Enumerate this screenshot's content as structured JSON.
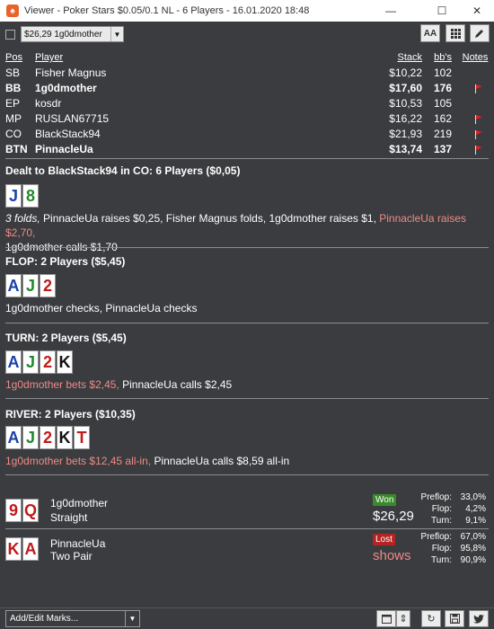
{
  "window": {
    "title": "Viewer - Poker Stars $0.05/0.1 NL - 6 Players - 16.01.2020 18:48",
    "app_icon": "pokerstars-logo-icon"
  },
  "toolbar": {
    "selected_hand": "$26,29 1g0dmother",
    "font_button": "AA",
    "grid_button_icon": "grid-icon",
    "edit_button_icon": "pencil-icon"
  },
  "players": {
    "headers": {
      "pos": "Pos",
      "player": "Player",
      "stack": "Stack",
      "bbs": "bb's",
      "notes": "Notes"
    },
    "rows": [
      {
        "pos": "SB",
        "player": "Fisher Magnus",
        "stack": "$10,22",
        "bbs": "102",
        "flag": false,
        "bold": false
      },
      {
        "pos": "BB",
        "player": "1g0dmother",
        "stack": "$17,60",
        "bbs": "176",
        "flag": true,
        "bold": true
      },
      {
        "pos": "EP",
        "player": "kosdr",
        "stack": "$10,53",
        "bbs": "105",
        "flag": false,
        "bold": false
      },
      {
        "pos": "MP",
        "player": "RUSLAN67715",
        "stack": "$16,22",
        "bbs": "162",
        "flag": true,
        "bold": false
      },
      {
        "pos": "CO",
        "player": "BlackStack94",
        "stack": "$21,93",
        "bbs": "219",
        "flag": true,
        "bold": false
      },
      {
        "pos": "BTN",
        "player": "PinnacleUa",
        "stack": "$13,74",
        "bbs": "137",
        "flag": true,
        "bold": true
      }
    ]
  },
  "preflop": {
    "title": "Dealt to BlackStack94 in CO: 6 Players ($0,05)",
    "cards": [
      {
        "rank": "J",
        "suit": "blue"
      },
      {
        "rank": "8",
        "suit": "green"
      }
    ],
    "line1": {
      "folds": "3 folds,",
      "a": " PinnacleUa raises $0,25, Fisher Magnus folds, 1g0dmother raises $1, ",
      "red": "PinnacleUa raises $2,70,"
    },
    "line2": "1g0dmother calls $1,70"
  },
  "flop": {
    "title": "FLOP: 2 Players ($5,45)",
    "cards": [
      {
        "rank": "A",
        "suit": "blue"
      },
      {
        "rank": "J",
        "suit": "green"
      },
      {
        "rank": "2",
        "suit": "red"
      }
    ],
    "action": "1g0dmother checks, PinnacleUa checks"
  },
  "turn": {
    "title": "TURN: 2 Players ($5,45)",
    "cards": [
      {
        "rank": "A",
        "suit": "blue"
      },
      {
        "rank": "J",
        "suit": "green"
      },
      {
        "rank": "2",
        "suit": "red"
      },
      {
        "rank": "K",
        "suit": "black"
      }
    ],
    "action_red": "1g0dmother bets $2,45,",
    "action_rest": " PinnacleUa calls $2,45"
  },
  "river": {
    "title": "RIVER: 2 Players ($10,35)",
    "cards": [
      {
        "rank": "A",
        "suit": "blue"
      },
      {
        "rank": "J",
        "suit": "green"
      },
      {
        "rank": "2",
        "suit": "red"
      },
      {
        "rank": "K",
        "suit": "black"
      },
      {
        "rank": "T",
        "suit": "red"
      }
    ],
    "action_red": "1g0dmother bets $12,45 all-in,",
    "action_rest": " PinnacleUa calls $8,59 all-in"
  },
  "results": [
    {
      "cards": [
        {
          "rank": "9",
          "suit": "red"
        },
        {
          "rank": "Q",
          "suit": "red"
        }
      ],
      "player": "1g0dmother",
      "hand": "Straight",
      "status": "Won",
      "amount": "$26,29",
      "stats": {
        "preflop_label": "Preflop:",
        "preflop": "33,0%",
        "flop_label": "Flop:",
        "flop": "4,2%",
        "turn_label": "Turn:",
        "turn": "9,1%"
      }
    },
    {
      "cards": [
        {
          "rank": "K",
          "suit": "red"
        },
        {
          "rank": "A",
          "suit": "red"
        }
      ],
      "player": "PinnacleUa",
      "hand": "Two Pair",
      "status": "Lost",
      "amount": "shows",
      "stats": {
        "preflop_label": "Preflop:",
        "preflop": "67,0%",
        "flop_label": "Flop:",
        "flop": "95,8%",
        "turn_label": "Turn:",
        "turn": "90,9%"
      }
    }
  ],
  "bottom": {
    "marks_placeholder": "Add/Edit Marks..."
  },
  "colors": {
    "background": "#3a3c3f",
    "accent_red_text": "#ee8b86",
    "won": "#3a8a2a",
    "lost": "#b32424",
    "flag": "#e02020"
  }
}
